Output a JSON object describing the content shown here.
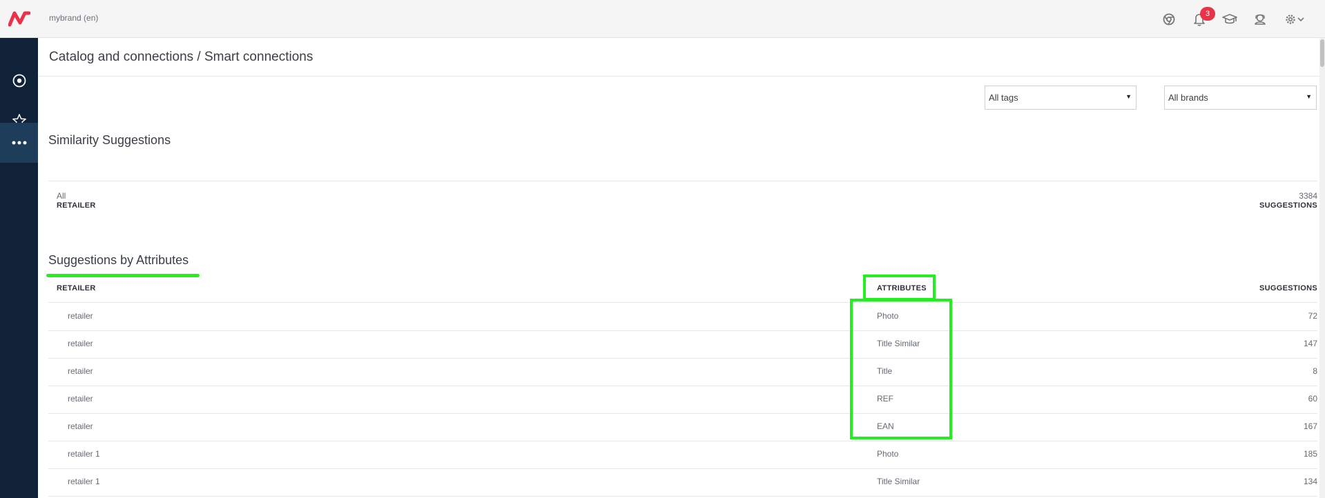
{
  "header": {
    "brand": "mybrand (en)",
    "notification_count": "3",
    "icons": [
      "chrome-icon",
      "bell-icon",
      "graduation-cap-icon",
      "support-icon",
      "gear-icon",
      "chevron-down-icon"
    ]
  },
  "sidebar": {
    "items": [
      {
        "icon": "dashboard-icon"
      },
      {
        "icon": "star-icon"
      },
      {
        "icon": "more-icon",
        "active": true
      }
    ]
  },
  "page": {
    "title": "Catalog and connections / Smart connections"
  },
  "filters": {
    "tags": {
      "value": "All tags"
    },
    "brands": {
      "value": "All brands"
    }
  },
  "similarity": {
    "title": "Similarity Suggestions",
    "columns": {
      "retailer": "RETAILER",
      "suggestions": "SUGGESTIONS"
    },
    "rows": [
      {
        "retailer": "All",
        "suggestions": "3384"
      }
    ]
  },
  "by_attributes": {
    "title": "Suggestions by Attributes",
    "columns": {
      "retailer": "RETAILER",
      "attributes": "ATTRIBUTES",
      "suggestions": "SUGGESTIONS"
    },
    "rows": [
      {
        "retailer": "retailer",
        "attribute": "Photo",
        "suggestions": "72"
      },
      {
        "retailer": "retailer",
        "attribute": "Title Similar",
        "suggestions": "147"
      },
      {
        "retailer": "retailer",
        "attribute": "Title",
        "suggestions": "8"
      },
      {
        "retailer": "retailer",
        "attribute": "REF",
        "suggestions": "60"
      },
      {
        "retailer": "retailer",
        "attribute": "EAN",
        "suggestions": "167"
      },
      {
        "retailer": "retailer 1",
        "attribute": "Photo",
        "suggestions": "185"
      },
      {
        "retailer": "retailer 1",
        "attribute": "Title Similar",
        "suggestions": "134"
      }
    ]
  },
  "colors": {
    "brand_red": "#e8334a",
    "sidebar_bg": "#0f2238",
    "sidebar_active": "#1e3d5a",
    "annotation_green": "#22ee22"
  }
}
